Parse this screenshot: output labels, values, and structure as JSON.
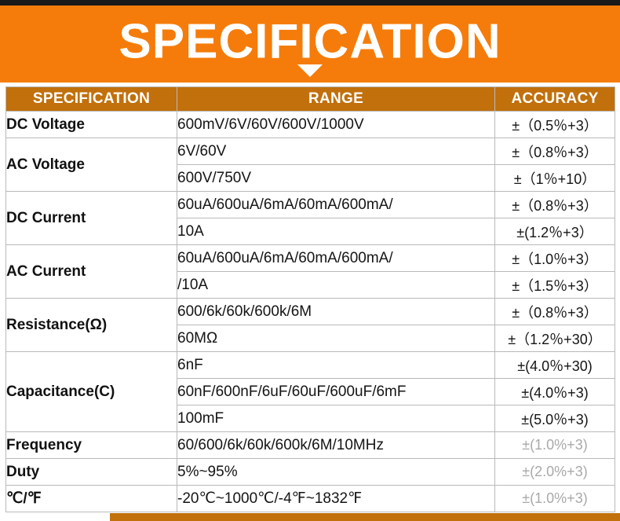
{
  "banner": {
    "title": "SPECIFICATION",
    "arrow_icon": "triangle-down-icon",
    "background_color": "#f57c0a",
    "text_color": "#ffffff"
  },
  "theme": {
    "banner_orange": "#f57c0a",
    "header_brown": "#c1700c",
    "border_gray": "#b9b9b9",
    "text_dark": "#141414",
    "text_dim": "#a9a9a9",
    "top_strip_black": "#1a1a1a"
  },
  "table": {
    "headers": {
      "specification": "SPECIFICATION",
      "range": "RANGE",
      "accuracy": "ACCURACY"
    },
    "rows": [
      {
        "spec": "DC Voltage",
        "entries": [
          {
            "range": "600mV/6V/60V/600V/1000V",
            "accuracy": "±（0.5％+3）",
            "dim": false
          }
        ]
      },
      {
        "spec": "AC Voltage",
        "entries": [
          {
            "range": "6V/60V",
            "accuracy": "±（0.8％+3）",
            "dim": false
          },
          {
            "range": "600V/750V",
            "accuracy": "±（1％+10）",
            "dim": false
          }
        ]
      },
      {
        "spec": "DC Current",
        "entries": [
          {
            "range": "60uA/600uA/6mA/60mA/600mA/",
            "accuracy": "±（0.8％+3）",
            "dim": false
          },
          {
            "range": "10A",
            "accuracy": "±(1.2％+3）",
            "dim": false
          }
        ]
      },
      {
        "spec": "AC Current",
        "entries": [
          {
            "range": "60uA/600uA/6mA/60mA/600mA/",
            "accuracy": "±（1.0％+3）",
            "dim": false
          },
          {
            "range": "/10A",
            "accuracy": "±（1.5％+3）",
            "dim": false
          }
        ]
      },
      {
        "spec": "Resistance(Ω)",
        "entries": [
          {
            "range": "600/6k/60k/600k/6M",
            "accuracy": "±（0.8％+3）",
            "dim": false
          },
          {
            "range": "60MΩ",
            "accuracy": "±（1.2％+30）",
            "dim": false
          }
        ]
      },
      {
        "spec": "Capacitance(C)",
        "entries": [
          {
            "range": "6nF",
            "accuracy": "±(4.0％+30)",
            "dim": false
          },
          {
            "range": "60nF/600nF/6uF/60uF/600uF/6mF",
            "accuracy": "±(4.0％+3)",
            "dim": false
          },
          {
            "range": "100mF",
            "accuracy": "±(5.0％+3)",
            "dim": false
          }
        ]
      },
      {
        "spec": "Frequency",
        "entries": [
          {
            "range": "60/600/6k/60k/600k/6M/10MHz",
            "accuracy": "±(1.0%+3)",
            "dim": true
          }
        ]
      },
      {
        "spec": "Duty",
        "entries": [
          {
            "range": "5%~95%",
            "accuracy": "±(2.0%+3)",
            "dim": true
          }
        ]
      },
      {
        "spec": "℃/℉",
        "entries": [
          {
            "range": "-20℃~1000℃/-4℉~1832℉",
            "accuracy": "±(1.0%+3)",
            "dim": true
          }
        ]
      }
    ]
  }
}
